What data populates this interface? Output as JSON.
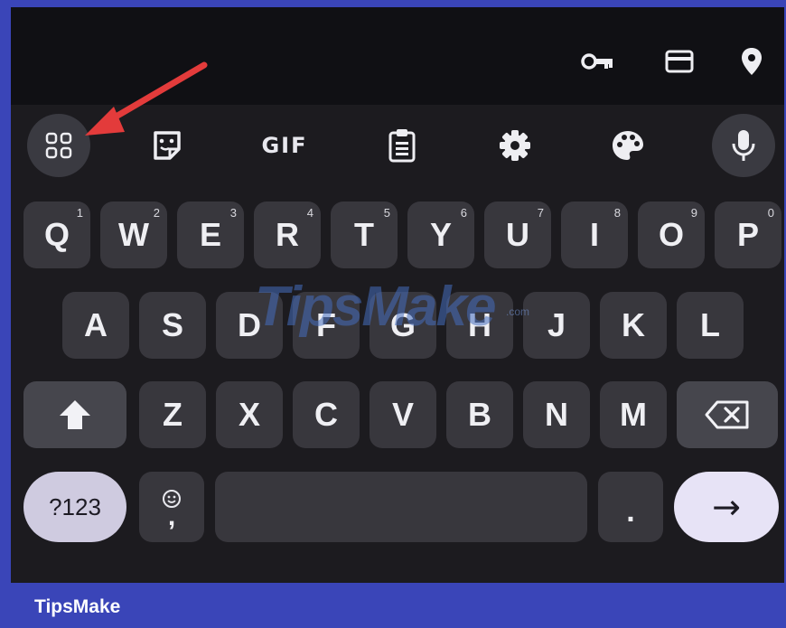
{
  "autofill_bar": {
    "icons": [
      "key-icon",
      "credit-card-icon",
      "location-pin-icon"
    ]
  },
  "toolbar": {
    "items": [
      {
        "name": "apps-grid-button",
        "icon": "grid-icon"
      },
      {
        "name": "sticker-button",
        "icon": "sticker-icon"
      },
      {
        "name": "gif-button",
        "label": "GIF"
      },
      {
        "name": "clipboard-button",
        "icon": "clipboard-icon"
      },
      {
        "name": "settings-button",
        "icon": "gear-icon"
      },
      {
        "name": "theme-button",
        "icon": "palette-icon"
      },
      {
        "name": "voice-input-button",
        "icon": "microphone-icon"
      }
    ]
  },
  "keyboard": {
    "row1": [
      {
        "k": "Q",
        "n": "1"
      },
      {
        "k": "W",
        "n": "2"
      },
      {
        "k": "E",
        "n": "3"
      },
      {
        "k": "R",
        "n": "4"
      },
      {
        "k": "T",
        "n": "5"
      },
      {
        "k": "Y",
        "n": "6"
      },
      {
        "k": "U",
        "n": "7"
      },
      {
        "k": "I",
        "n": "8"
      },
      {
        "k": "O",
        "n": "9"
      },
      {
        "k": "P",
        "n": "0"
      }
    ],
    "row2": [
      "A",
      "S",
      "D",
      "F",
      "G",
      "H",
      "J",
      "K",
      "L"
    ],
    "row3": [
      "Z",
      "X",
      "C",
      "V",
      "B",
      "N",
      "M"
    ],
    "symbols_label": "?123",
    "comma_label": ",",
    "period_label": ".",
    "enter_label": "→",
    "shift_icon": "shift-arrow-icon",
    "backspace_icon": "backspace-icon",
    "emoji_icon": "smiley-icon"
  },
  "watermark": {
    "text": "TipsMake",
    "suffix": ".com"
  },
  "footer": {
    "brand": "TipsMake"
  },
  "colors": {
    "annotation_arrow": "#e33b3b",
    "frame": "#3a45b8",
    "keyboard_bg": "#1c1b1f",
    "key_bg": "#38373d",
    "enter_bg": "#e7e3f6"
  }
}
